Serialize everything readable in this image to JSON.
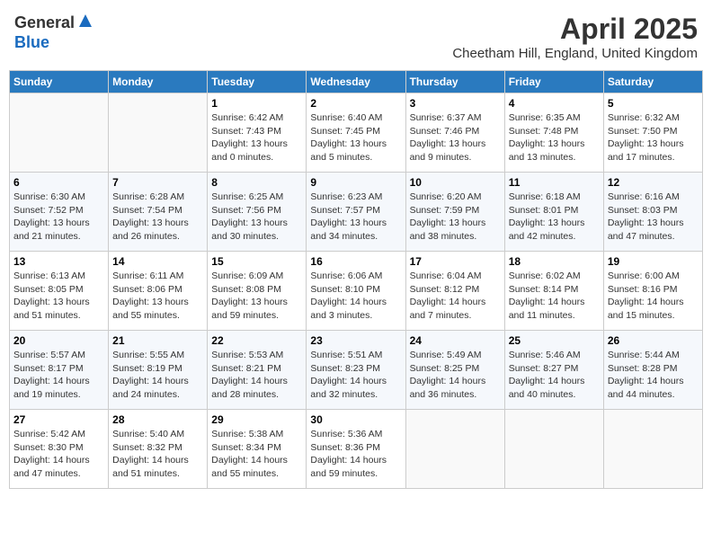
{
  "logo": {
    "general": "General",
    "blue": "Blue"
  },
  "title": "April 2025",
  "location": "Cheetham Hill, England, United Kingdom",
  "days_of_week": [
    "Sunday",
    "Monday",
    "Tuesday",
    "Wednesday",
    "Thursday",
    "Friday",
    "Saturday"
  ],
  "weeks": [
    [
      {
        "day": "",
        "info": ""
      },
      {
        "day": "",
        "info": ""
      },
      {
        "day": "1",
        "info": "Sunrise: 6:42 AM\nSunset: 7:43 PM\nDaylight: 13 hours and 0 minutes."
      },
      {
        "day": "2",
        "info": "Sunrise: 6:40 AM\nSunset: 7:45 PM\nDaylight: 13 hours and 5 minutes."
      },
      {
        "day": "3",
        "info": "Sunrise: 6:37 AM\nSunset: 7:46 PM\nDaylight: 13 hours and 9 minutes."
      },
      {
        "day": "4",
        "info": "Sunrise: 6:35 AM\nSunset: 7:48 PM\nDaylight: 13 hours and 13 minutes."
      },
      {
        "day": "5",
        "info": "Sunrise: 6:32 AM\nSunset: 7:50 PM\nDaylight: 13 hours and 17 minutes."
      }
    ],
    [
      {
        "day": "6",
        "info": "Sunrise: 6:30 AM\nSunset: 7:52 PM\nDaylight: 13 hours and 21 minutes."
      },
      {
        "day": "7",
        "info": "Sunrise: 6:28 AM\nSunset: 7:54 PM\nDaylight: 13 hours and 26 minutes."
      },
      {
        "day": "8",
        "info": "Sunrise: 6:25 AM\nSunset: 7:56 PM\nDaylight: 13 hours and 30 minutes."
      },
      {
        "day": "9",
        "info": "Sunrise: 6:23 AM\nSunset: 7:57 PM\nDaylight: 13 hours and 34 minutes."
      },
      {
        "day": "10",
        "info": "Sunrise: 6:20 AM\nSunset: 7:59 PM\nDaylight: 13 hours and 38 minutes."
      },
      {
        "day": "11",
        "info": "Sunrise: 6:18 AM\nSunset: 8:01 PM\nDaylight: 13 hours and 42 minutes."
      },
      {
        "day": "12",
        "info": "Sunrise: 6:16 AM\nSunset: 8:03 PM\nDaylight: 13 hours and 47 minutes."
      }
    ],
    [
      {
        "day": "13",
        "info": "Sunrise: 6:13 AM\nSunset: 8:05 PM\nDaylight: 13 hours and 51 minutes."
      },
      {
        "day": "14",
        "info": "Sunrise: 6:11 AM\nSunset: 8:06 PM\nDaylight: 13 hours and 55 minutes."
      },
      {
        "day": "15",
        "info": "Sunrise: 6:09 AM\nSunset: 8:08 PM\nDaylight: 13 hours and 59 minutes."
      },
      {
        "day": "16",
        "info": "Sunrise: 6:06 AM\nSunset: 8:10 PM\nDaylight: 14 hours and 3 minutes."
      },
      {
        "day": "17",
        "info": "Sunrise: 6:04 AM\nSunset: 8:12 PM\nDaylight: 14 hours and 7 minutes."
      },
      {
        "day": "18",
        "info": "Sunrise: 6:02 AM\nSunset: 8:14 PM\nDaylight: 14 hours and 11 minutes."
      },
      {
        "day": "19",
        "info": "Sunrise: 6:00 AM\nSunset: 8:16 PM\nDaylight: 14 hours and 15 minutes."
      }
    ],
    [
      {
        "day": "20",
        "info": "Sunrise: 5:57 AM\nSunset: 8:17 PM\nDaylight: 14 hours and 19 minutes."
      },
      {
        "day": "21",
        "info": "Sunrise: 5:55 AM\nSunset: 8:19 PM\nDaylight: 14 hours and 24 minutes."
      },
      {
        "day": "22",
        "info": "Sunrise: 5:53 AM\nSunset: 8:21 PM\nDaylight: 14 hours and 28 minutes."
      },
      {
        "day": "23",
        "info": "Sunrise: 5:51 AM\nSunset: 8:23 PM\nDaylight: 14 hours and 32 minutes."
      },
      {
        "day": "24",
        "info": "Sunrise: 5:49 AM\nSunset: 8:25 PM\nDaylight: 14 hours and 36 minutes."
      },
      {
        "day": "25",
        "info": "Sunrise: 5:46 AM\nSunset: 8:27 PM\nDaylight: 14 hours and 40 minutes."
      },
      {
        "day": "26",
        "info": "Sunrise: 5:44 AM\nSunset: 8:28 PM\nDaylight: 14 hours and 44 minutes."
      }
    ],
    [
      {
        "day": "27",
        "info": "Sunrise: 5:42 AM\nSunset: 8:30 PM\nDaylight: 14 hours and 47 minutes."
      },
      {
        "day": "28",
        "info": "Sunrise: 5:40 AM\nSunset: 8:32 PM\nDaylight: 14 hours and 51 minutes."
      },
      {
        "day": "29",
        "info": "Sunrise: 5:38 AM\nSunset: 8:34 PM\nDaylight: 14 hours and 55 minutes."
      },
      {
        "day": "30",
        "info": "Sunrise: 5:36 AM\nSunset: 8:36 PM\nDaylight: 14 hours and 59 minutes."
      },
      {
        "day": "",
        "info": ""
      },
      {
        "day": "",
        "info": ""
      },
      {
        "day": "",
        "info": ""
      }
    ]
  ]
}
